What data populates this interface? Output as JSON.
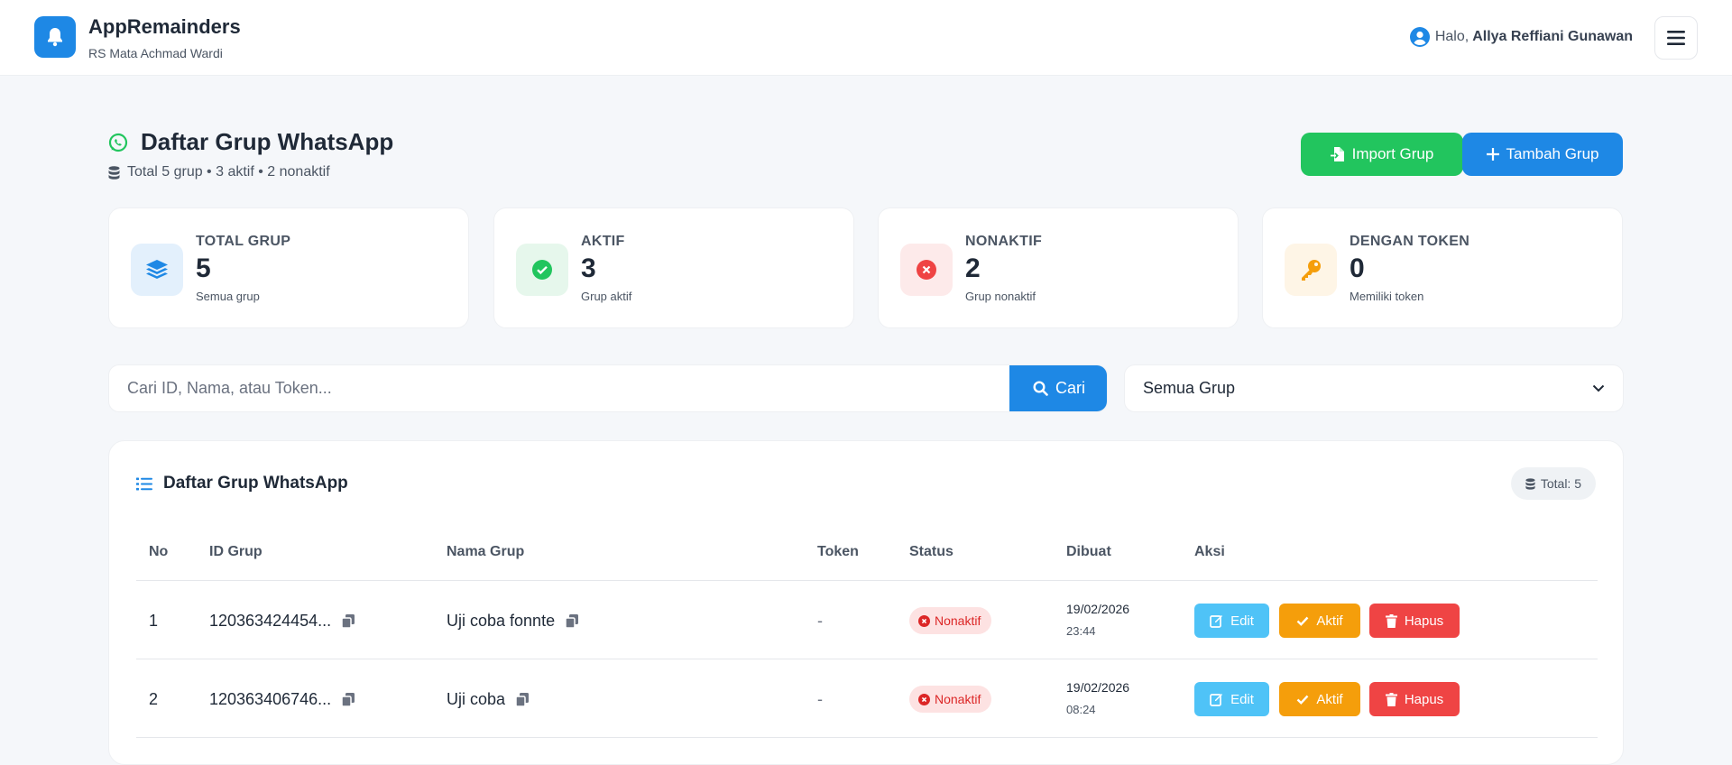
{
  "app": {
    "title": "AppRemainders",
    "subtitle": "RS Mata Achmad Wardi",
    "greeting": "Halo,",
    "user_name": "Allya Reffiani Gunawan"
  },
  "header": {
    "title": "Daftar Grup WhatsApp",
    "summary": "Total 5 grup • 3 aktif • 2 nonaktif",
    "import_label": "Import Grup",
    "add_label": "Tambah Grup"
  },
  "stats": [
    {
      "label": "TOTAL GRUP",
      "value": "5",
      "desc": "Semua grup",
      "icon": "layers-icon",
      "color": "#1e88e5"
    },
    {
      "label": "AKTIF",
      "value": "3",
      "desc": "Grup aktif",
      "icon": "check-circle-icon",
      "color": "#22c55e"
    },
    {
      "label": "NONAKTIF",
      "value": "2",
      "desc": "Grup nonaktif",
      "icon": "x-circle-icon",
      "color": "#ef4444"
    },
    {
      "label": "DENGAN TOKEN",
      "value": "0",
      "desc": "Memiliki token",
      "icon": "key-icon",
      "color": "#f59e0b"
    }
  ],
  "search": {
    "placeholder": "Cari ID, Nama, atau Token...",
    "button_label": "Cari",
    "filter_selected": "Semua Grup"
  },
  "table": {
    "title": "Daftar Grup WhatsApp",
    "total_label": "Total: 5",
    "columns": [
      "No",
      "ID Grup",
      "Nama Grup",
      "Token",
      "Status",
      "Dibuat",
      "Aksi"
    ],
    "rows": [
      {
        "no": "1",
        "id": "120363424454...",
        "name": "Uji coba fonnte",
        "token": "-",
        "status": "Nonaktif",
        "date": "19/02/2026",
        "time": "23:44"
      },
      {
        "no": "2",
        "id": "120363406746...",
        "name": "Uji coba",
        "token": "-",
        "status": "Nonaktif",
        "date": "19/02/2026",
        "time": "08:24"
      }
    ],
    "actions": {
      "edit": "Edit",
      "aktif": "Aktif",
      "hapus": "Hapus"
    }
  }
}
